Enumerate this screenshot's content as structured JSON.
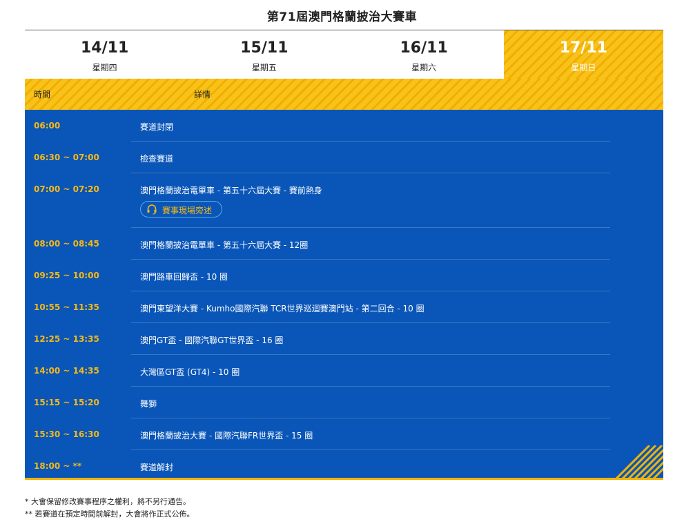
{
  "page": {
    "title": "第71屆澳門格蘭披治大賽車"
  },
  "tabs": [
    {
      "date": "14/11",
      "day": "星期四",
      "active": false
    },
    {
      "date": "15/11",
      "day": "星期五",
      "active": false
    },
    {
      "date": "16/11",
      "day": "星期六",
      "active": false
    },
    {
      "date": "17/11",
      "day": "星期日",
      "active": true
    }
  ],
  "table_header": {
    "time": "時間",
    "detail": "詳情"
  },
  "schedule": [
    {
      "time": "06:00",
      "detail": "賽道封閉"
    },
    {
      "time": "06:30 ~ 07:00",
      "detail": "檢查賽道"
    },
    {
      "time": "07:00 ~ 07:20",
      "detail": "澳門格蘭披治電單車 - 第五十六屆大賽 - 賽前熱身",
      "badge": "賽事現場旁述"
    },
    {
      "time": "08:00 ~ 08:45",
      "detail": "澳門格蘭披治電單車 - 第五十六屆大賽 - 12圈"
    },
    {
      "time": "09:25 ~ 10:00",
      "detail": "澳門路車回歸盃 - 10 圈"
    },
    {
      "time": "10:55 ~ 11:35",
      "detail": "澳門東望洋大賽 - Kumho國際汽聯 TCR世界巡迴賽澳門站 - 第二回合 - 10 圈"
    },
    {
      "time": "12:25 ~ 13:35",
      "detail": "澳門GT盃 - 國際汽聯GT世界盃 - 16 圈"
    },
    {
      "time": "14:00 ~ 14:35",
      "detail": "大灣區GT盃 (GT4) - 10 圈"
    },
    {
      "time": "15:15 ~ 15:20",
      "detail": "舞獅"
    },
    {
      "time": "15:30 ~ 16:30",
      "detail": "澳門格蘭披治大賽 - 國際汽聯FR世界盃 - 15 圈"
    },
    {
      "time": "18:00 ~ **",
      "detail": "賽道解封"
    }
  ],
  "notes": [
    "* 大會保留修改賽事程序之權利，將不另行通告。",
    "** 若賽道在預定時間前解封，大會將作正式公佈。"
  ],
  "colors": {
    "accent": "#f6b915",
    "panel": "#0a56b8",
    "stripe": "#f3ad00"
  }
}
